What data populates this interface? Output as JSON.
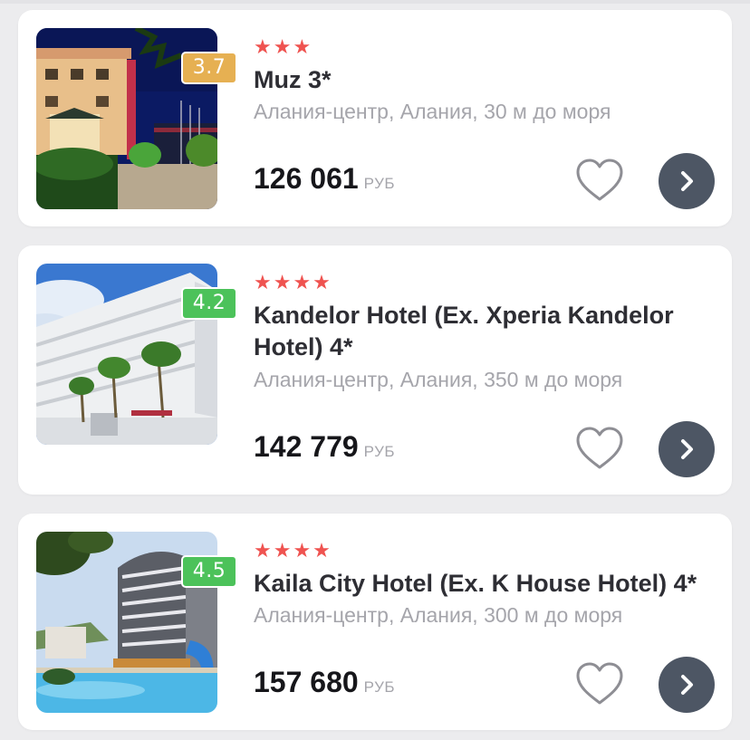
{
  "colors": {
    "star": "#ef5350",
    "rating_mid": "#e6b052",
    "rating_high": "#4cc25a",
    "button": "#4d5664",
    "muted_text": "#a5a5ab"
  },
  "icons": {
    "favorite": "heart-outline-icon",
    "open": "chevron-right-icon"
  },
  "hotels": [
    {
      "stars_text": "★★★",
      "rating": "3.7",
      "rating_color": "#e6b052",
      "name": "Muz 3*",
      "location": "Алания-центр, Алания, 30 м до моря",
      "price": "126 061",
      "currency": "РУБ"
    },
    {
      "stars_text": "★★★★",
      "rating": "4.2",
      "rating_color": "#4cc25a",
      "name": "Kandelor Hotel (Ex. Xperia Kandelor Hotel) 4*",
      "location": "Алания-центр, Алания, 350 м до моря",
      "price": "142 779",
      "currency": "РУБ"
    },
    {
      "stars_text": "★★★★",
      "rating": "4.5",
      "rating_color": "#4cc25a",
      "name": "Kaila City Hotel (Ex. K House Hotel) 4*",
      "location": "Алания-центр, Алания, 300 м до моря",
      "price": "157 680",
      "currency": "РУБ"
    }
  ]
}
